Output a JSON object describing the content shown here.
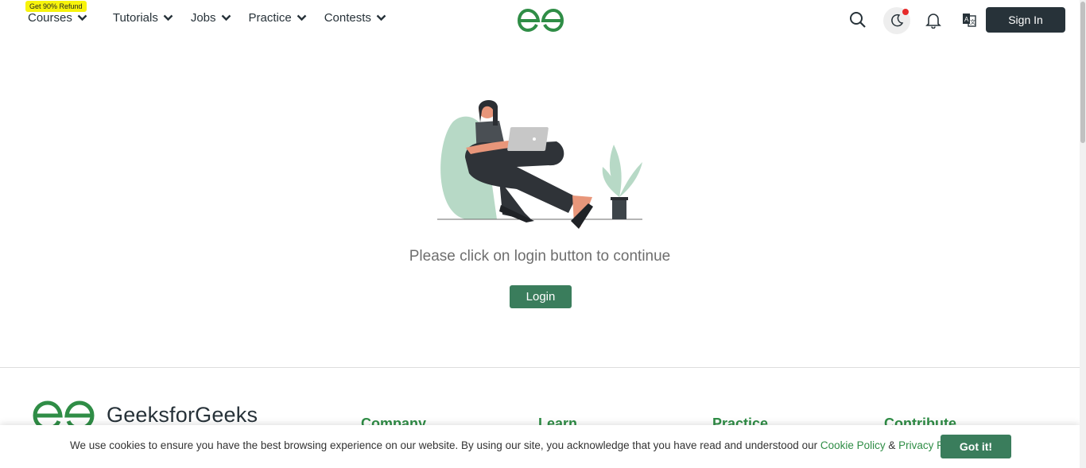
{
  "header": {
    "refund_badge": "Get 90% Refund",
    "nav": [
      {
        "label": "Courses"
      },
      {
        "label": "Tutorials"
      },
      {
        "label": "Jobs"
      },
      {
        "label": "Practice"
      },
      {
        "label": "Contests"
      }
    ],
    "signin_label": "Sign In",
    "icons": [
      "search-icon",
      "moon-icon",
      "bell-icon",
      "translate-icon"
    ]
  },
  "main": {
    "prompt": "Please click on login button to continue",
    "login_label": "Login"
  },
  "footer": {
    "brand": "GeeksforGeeks",
    "columns": [
      "Company",
      "Learn",
      "Practice",
      "Contribute"
    ]
  },
  "cookie": {
    "text": "We use cookies to ensure you have the best browsing experience on our website. By using our site, you acknowledge that you have read and understood our ",
    "cookie_policy": "Cookie Policy",
    "amp": " & ",
    "privacy_policy": "Privacy Policy",
    "button": "Got it!"
  },
  "colors": {
    "brand_green": "#2f8d46",
    "button_green": "#3a7d5c",
    "dark": "#273239"
  }
}
